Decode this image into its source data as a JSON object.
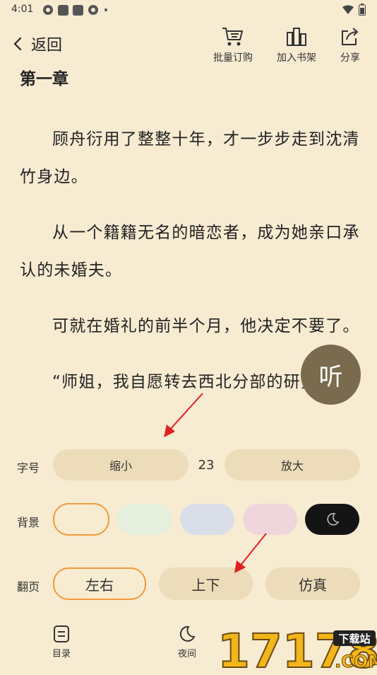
{
  "status": {
    "time": "4:01"
  },
  "header": {
    "back_label": "返回",
    "batch_label": "批量订购",
    "shelf_label": "加入书架",
    "share_label": "分享"
  },
  "content": {
    "chapter_title": "第一章",
    "paragraphs": [
      "顾舟衍用了整整十年，才一步步走到沈清竹身边。",
      "从一个籍籍无名的暗恋者，成为她亲口承认的未婚夫。",
      "可就在婚礼的前半个月，他决定不要了。",
      "“师姐，我自愿转去西北分部的研究"
    ]
  },
  "listen_label": "听",
  "settings": {
    "font_size": {
      "label": "字号",
      "decrease": "缩小",
      "value": "23",
      "increase": "放大"
    },
    "background": {
      "label": "背景",
      "swatches": [
        "#f7ebd2",
        "#e6efdd",
        "#dadee9",
        "#efd6dc",
        "#141414"
      ],
      "selected_index": 0
    },
    "page_turn": {
      "label": "翻页",
      "options": [
        "左右",
        "上下",
        "仿真"
      ],
      "selected_index": 0
    }
  },
  "bottom_nav": {
    "toc_label": "目录",
    "night_label": "夜间"
  },
  "watermark": {
    "text": "17178",
    "sub": "下载站",
    "domain": ".COM"
  },
  "colors": {
    "accent": "#f29a3a",
    "annotation": "#e02020",
    "listen_bg": "#7a6a4e"
  }
}
